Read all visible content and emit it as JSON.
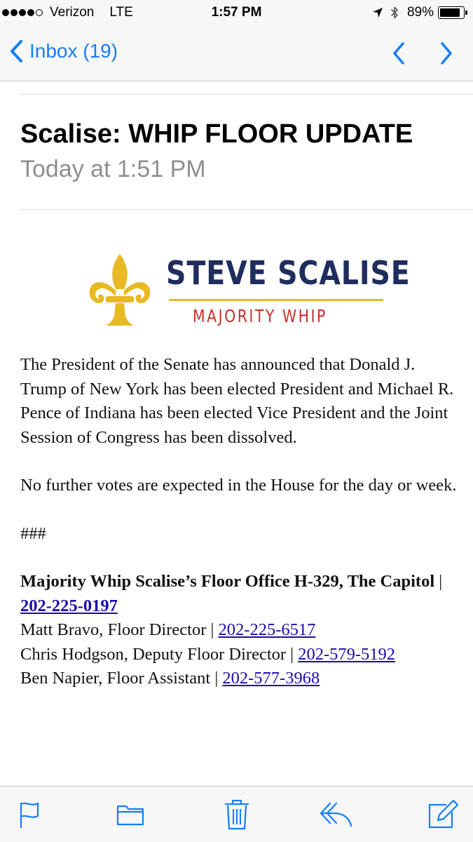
{
  "status_bar": {
    "carrier": "Verizon",
    "network": "LTE",
    "time": "1:57 PM",
    "battery": "89%",
    "battery_level": 0.89,
    "signal_bars_filled": 4,
    "signal_bars_total": 5
  },
  "nav": {
    "back_label": "Inbox (19)",
    "accent_color": "#147efb"
  },
  "message": {
    "subject": "Scalise: WHIP FLOOR UPDATE",
    "date": "Today at 1:51 PM"
  },
  "logo": {
    "name": "STEVE SCALISE",
    "title": "MAJORITY WHIP",
    "name_color": "#1f2d5e",
    "title_color": "#c8322a",
    "emblem_color": "#e8b923"
  },
  "body": {
    "paragraph_1": "The President of the Senate has announced that Donald J. Trump of New York has been elected President and Michael R. Pence of Indiana has been elected Vice President and the Joint Session of Congress has been dissolved.",
    "paragraph_2": "No further votes are expected in the House for the day or week.",
    "separator": "###",
    "office_label": "Majority Whip Scalise’s Floor Office H-329, The Capitol",
    "office_phone": "202-225-0197",
    "contacts": [
      {
        "text": "Matt Bravo, Floor Director",
        "phone": "202-225-6517"
      },
      {
        "text": "Chris Hodgson, Deputy Floor Director",
        "phone": "202-579-5192"
      },
      {
        "text": "Ben Napier, Floor Assistant",
        "phone": "202-577-3968"
      }
    ],
    "divider": "|",
    "link_color": "#1a0dab"
  },
  "toolbar": {
    "icons": [
      "flag-icon",
      "folder-icon",
      "trash-icon",
      "reply-icon",
      "compose-icon"
    ]
  }
}
